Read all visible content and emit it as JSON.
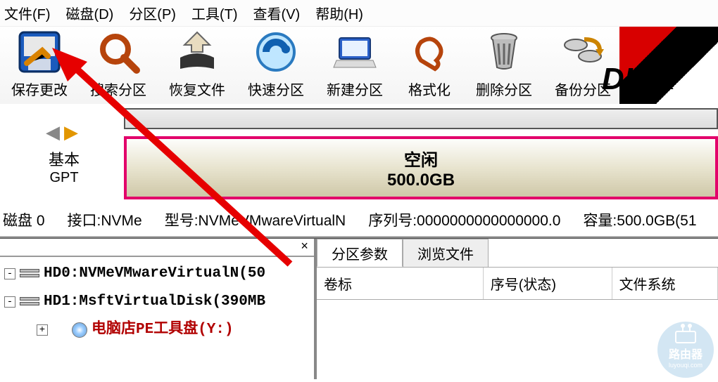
{
  "menubar": {
    "file": "文件(F)",
    "disk": "磁盘(D)",
    "partition": "分区(P)",
    "tools": "工具(T)",
    "view": "查看(V)",
    "help": "帮助(H)"
  },
  "toolbar": {
    "save": "保存更改",
    "search": "搜索分区",
    "recover": "恢复文件",
    "quick": "快速分区",
    "newpart": "新建分区",
    "format": "格式化",
    "delete": "删除分区",
    "backup": "备份分区"
  },
  "brand": "DISK",
  "disk_left": {
    "type": "基本",
    "scheme": "GPT"
  },
  "selected": {
    "state": "空闲",
    "size": "500.0GB"
  },
  "infoline": {
    "disk": "磁盘 0",
    "iface": "接口:NVMe",
    "model": "型号:NVMeVMwareVirtualN",
    "serial": "序列号:0000000000000000.0",
    "capacity": "容量:500.0GB(51"
  },
  "tree": {
    "hd0": "HD0:NVMeVMwareVirtualN(50",
    "hd1": "HD1:MsftVirtualDisk(390MB",
    "pe": "电脑店PE工具盘(Y:)"
  },
  "tabs": {
    "params": "分区参数",
    "browse": "浏览文件"
  },
  "columns": {
    "label": "卷标",
    "serial": "序号(状态)",
    "fs": "文件系统"
  },
  "watermark": {
    "l1": "路由器",
    "l2": "luyouqi.com"
  }
}
